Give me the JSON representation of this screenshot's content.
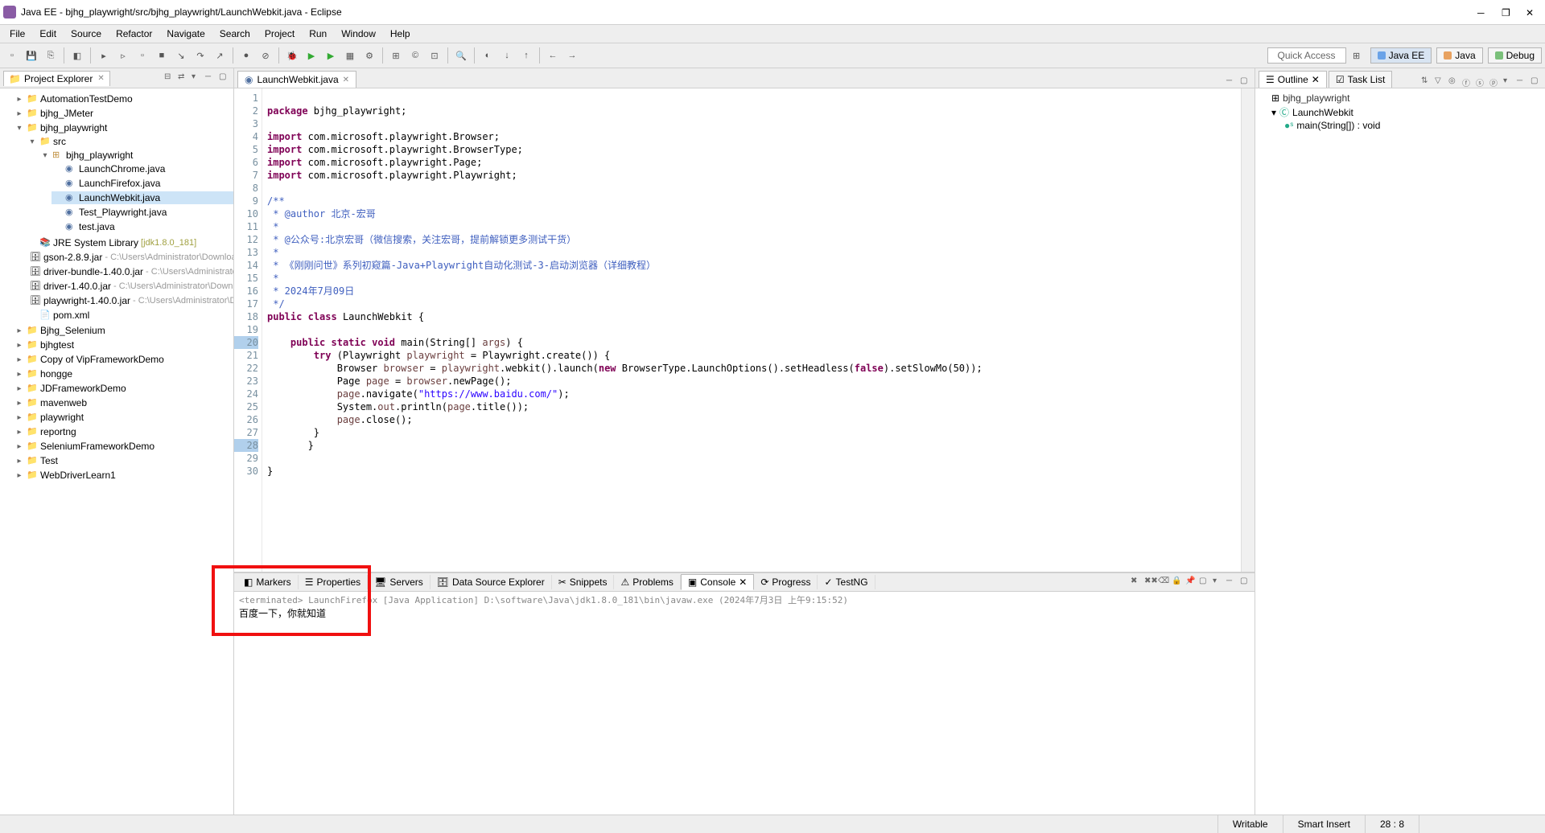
{
  "title": "Java EE - bjhg_playwright/src/bjhg_playwright/LaunchWebkit.java - Eclipse",
  "menu": [
    "File",
    "Edit",
    "Source",
    "Refactor",
    "Navigate",
    "Search",
    "Project",
    "Run",
    "Window",
    "Help"
  ],
  "quick_access": "Quick Access",
  "perspectives": {
    "java_ee": "Java EE",
    "java": "Java",
    "debug": "Debug"
  },
  "project_explorer": {
    "title": "Project Explorer",
    "projects": [
      {
        "name": "AutomationTestDemo",
        "open": false
      },
      {
        "name": "bjhg_JMeter",
        "open": false
      },
      {
        "name": "bjhg_playwright",
        "open": true,
        "children": [
          {
            "name": "src",
            "type": "srcfolder",
            "open": true,
            "children": [
              {
                "name": "bjhg_playwright",
                "type": "package",
                "open": true,
                "children": [
                  {
                    "name": "LaunchChrome.java",
                    "type": "java"
                  },
                  {
                    "name": "LaunchFirefox.java",
                    "type": "java"
                  },
                  {
                    "name": "LaunchWebkit.java",
                    "type": "java",
                    "selected": true
                  },
                  {
                    "name": "Test_Playwright.java",
                    "type": "java"
                  },
                  {
                    "name": "test.java",
                    "type": "java"
                  }
                ]
              }
            ]
          },
          {
            "name": "JRE System Library",
            "hint": "[jdk1.8.0_181]",
            "type": "jre"
          },
          {
            "name": "gson-2.8.9.jar",
            "hint": " - C:\\Users\\Administrator\\Downloads",
            "type": "jar"
          },
          {
            "name": "driver-bundle-1.40.0.jar",
            "hint": " - C:\\Users\\Administrator\\C",
            "type": "jar"
          },
          {
            "name": "driver-1.40.0.jar",
            "hint": " - C:\\Users\\Administrator\\Download",
            "type": "jar"
          },
          {
            "name": "playwright-1.40.0.jar",
            "hint": " - C:\\Users\\Administrator\\Dow",
            "type": "jar"
          },
          {
            "name": "pom.xml",
            "type": "xml"
          }
        ]
      },
      {
        "name": "Bjhg_Selenium",
        "open": false,
        "decorator": "red"
      },
      {
        "name": "bjhgtest",
        "open": false
      },
      {
        "name": "Copy of VipFrameworkDemo",
        "open": false
      },
      {
        "name": "hongge",
        "open": false
      },
      {
        "name": "JDFrameworkDemo",
        "open": false
      },
      {
        "name": "mavenweb",
        "open": false
      },
      {
        "name": "playwright",
        "open": false
      },
      {
        "name": "reportng",
        "open": false
      },
      {
        "name": "SeleniumFrameworkDemo",
        "open": false
      },
      {
        "name": "Test",
        "open": false
      },
      {
        "name": "WebDriverLearn1",
        "open": false
      }
    ]
  },
  "editor": {
    "tab": "LaunchWebkit.java",
    "lines": [
      {
        "n": 1,
        "t": ""
      },
      {
        "n": 2,
        "t": "package bjhg_playwright;",
        "tokens": [
          [
            "kw",
            "package"
          ],
          [
            "",
            ""
          ],
          [
            "typ",
            " bjhg_playwright;"
          ]
        ]
      },
      {
        "n": 3,
        "t": ""
      },
      {
        "n": 4,
        "t": "import com.microsoft.playwright.Browser;",
        "tokens": [
          [
            "kw",
            "import"
          ],
          [
            "",
            " com.microsoft.playwright.Browser;"
          ]
        ]
      },
      {
        "n": 5,
        "t": "import com.microsoft.playwright.BrowserType;",
        "tokens": [
          [
            "kw",
            "import"
          ],
          [
            "",
            " com.microsoft.playwright.BrowserType;"
          ]
        ]
      },
      {
        "n": 6,
        "t": "import com.microsoft.playwright.Page;",
        "tokens": [
          [
            "kw",
            "import"
          ],
          [
            "",
            " com.microsoft.playwright.Page;"
          ]
        ]
      },
      {
        "n": 7,
        "t": "import com.microsoft.playwright.Playwright;",
        "tokens": [
          [
            "kw",
            "import"
          ],
          [
            "",
            " com.microsoft.playwright.Playwright;"
          ]
        ]
      },
      {
        "n": 8,
        "t": ""
      },
      {
        "n": 9,
        "raw": "/**",
        "cls": "doc"
      },
      {
        "n": 10,
        "raw": " * @author 北京-宏哥",
        "cls": "doc"
      },
      {
        "n": 11,
        "raw": " *",
        "cls": "doc"
      },
      {
        "n": 12,
        "raw": " * @公众号:北京宏哥（微信搜索，关注宏哥，提前解锁更多测试干货）",
        "cls": "doc"
      },
      {
        "n": 13,
        "raw": " *",
        "cls": "doc"
      },
      {
        "n": 14,
        "raw": " * 《刚刚问世》系列初窥篇-Java+Playwright自动化测试-3-启动浏览器（详细教程）",
        "cls": "doc"
      },
      {
        "n": 15,
        "raw": " *",
        "cls": "doc"
      },
      {
        "n": 16,
        "raw": " * 2024年7月09日",
        "cls": "doc"
      },
      {
        "n": 17,
        "raw": " */",
        "cls": "doc"
      },
      {
        "n": 18,
        "tokens": [
          [
            "kw",
            "public"
          ],
          [
            "",
            " "
          ],
          [
            "kw",
            "class"
          ],
          [
            "",
            " LaunchWebkit {"
          ]
        ]
      },
      {
        "n": 19,
        "t": ""
      },
      {
        "n": 20,
        "hl": true,
        "pad": "    ",
        "tokens": [
          [
            "kw",
            "public"
          ],
          [
            "",
            " "
          ],
          [
            "kw",
            "static"
          ],
          [
            "",
            " "
          ],
          [
            "kw",
            "void"
          ],
          [
            "",
            " main(String[] "
          ],
          [
            "var",
            "args"
          ],
          [
            "",
            ") {"
          ]
        ]
      },
      {
        "n": 21,
        "pad": "        ",
        "tokens": [
          [
            "kw",
            "try"
          ],
          [
            "",
            " (Playwright "
          ],
          [
            "var",
            "playwright"
          ],
          [
            "",
            " = Playwright.create()) {"
          ]
        ]
      },
      {
        "n": 22,
        "pad": "            ",
        "tokens": [
          [
            "",
            "Browser "
          ],
          [
            "var",
            "browser"
          ],
          [
            "",
            " = "
          ],
          [
            "var",
            "playwright"
          ],
          [
            "",
            ".webkit().launch("
          ],
          [
            "kw",
            "new"
          ],
          [
            "",
            " BrowserType.LaunchOptions().setHeadless("
          ],
          [
            "kw",
            "false"
          ],
          [
            "",
            ").setSlowMo(50));"
          ]
        ]
      },
      {
        "n": 23,
        "pad": "            ",
        "tokens": [
          [
            "",
            "Page "
          ],
          [
            "var",
            "page"
          ],
          [
            "",
            " = "
          ],
          [
            "var",
            "browser"
          ],
          [
            "",
            ".newPage();"
          ]
        ]
      },
      {
        "n": 24,
        "pad": "            ",
        "tokens": [
          [
            "var",
            "page"
          ],
          [
            "",
            ".navigate("
          ],
          [
            "str",
            "\"https://www.baidu.com/\""
          ],
          [
            "",
            ");"
          ]
        ]
      },
      {
        "n": 25,
        "pad": "            ",
        "tokens": [
          [
            "",
            "System."
          ],
          [
            "var",
            "out"
          ],
          [
            "",
            ".println("
          ],
          [
            "var",
            "page"
          ],
          [
            "",
            ".title());"
          ]
        ]
      },
      {
        "n": 26,
        "pad": "            ",
        "tokens": [
          [
            "var",
            "page"
          ],
          [
            "",
            ".close();"
          ]
        ]
      },
      {
        "n": 27,
        "pad": "        ",
        "t": "}"
      },
      {
        "n": 28,
        "hl": true,
        "pad": "       ",
        "t": "}"
      },
      {
        "n": 29,
        "t": ""
      },
      {
        "n": 30,
        "t": "}"
      }
    ]
  },
  "bottom_tabs": [
    "Markers",
    "Properties",
    "Servers",
    "Data Source Explorer",
    "Snippets",
    "Problems",
    "Console",
    "Progress",
    "TestNG"
  ],
  "bottom_active": "Console",
  "console": {
    "status": "<terminated> LaunchFirefox [Java Application] D:\\software\\Java\\jdk1.8.0_181\\bin\\javaw.exe (2024年7月3日 上午9:15:52)",
    "output": "百度一下，你就知道"
  },
  "outline": {
    "tabs": [
      "Outline",
      "Task List"
    ],
    "package": "bjhg_playwright",
    "class": "LaunchWebkit",
    "method": "main(String[]) : void"
  },
  "status": {
    "writable": "Writable",
    "insert": "Smart Insert",
    "pos": "28 : 8"
  }
}
